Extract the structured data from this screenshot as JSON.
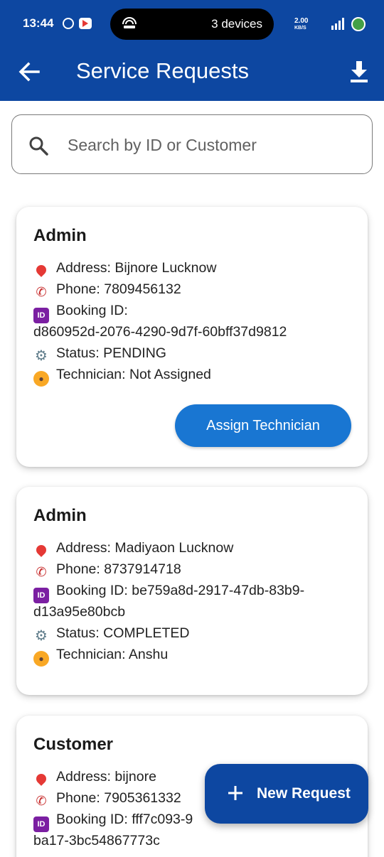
{
  "status_bar": {
    "time": "13:44",
    "cast_label": "3 devices",
    "net_rate_value": "2.00",
    "net_rate_unit": "KB/S"
  },
  "app_bar": {
    "title": "Service Requests"
  },
  "search": {
    "placeholder": "Search by ID or Customer"
  },
  "requests": [
    {
      "name": "Admin",
      "address": "Address: Bijnore Lucknow",
      "phone": "Phone: 7809456132",
      "booking_line1": "Booking ID:",
      "booking_line2": "d860952d-2076-4290-9d7f-60bff37d9812",
      "status": "Status: PENDING",
      "technician": "Technician: Not Assigned",
      "action_label": "Assign Technician"
    },
    {
      "name": "Admin",
      "address": "Address: Madiyaon Lucknow",
      "phone": "Phone: 8737914718",
      "booking_line1": "Booking ID: be759a8d-2917-47db-83b9-",
      "booking_line2": "d13a95e80bcb",
      "status": "Status: COMPLETED",
      "technician": "Technician: Anshu"
    },
    {
      "name": "Customer",
      "address": "Address: bijnore",
      "phone": "Phone: 7905361332",
      "booking_line1": "Booking ID: fff7c093-9",
      "booking_line2": "ba17-3bc54867773c"
    }
  ],
  "fab": {
    "label": "New Request"
  },
  "icons": [
    "back-arrow-icon",
    "download-icon",
    "search-icon",
    "plus-icon",
    "pin-icon",
    "phone-icon",
    "id-icon",
    "gear-icon",
    "technician-icon"
  ],
  "colors": {
    "primary": "#0d47a1",
    "button": "#1976d2"
  }
}
